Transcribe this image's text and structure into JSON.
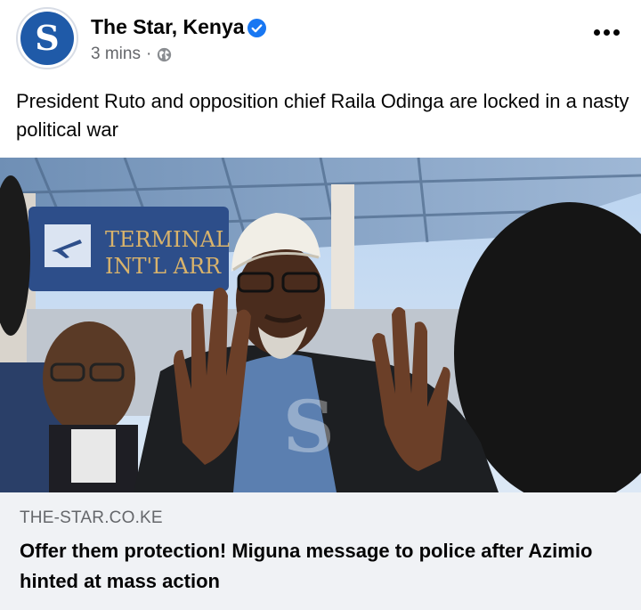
{
  "post": {
    "page_name": "The Star, Kenya",
    "avatar_letter": "S",
    "time": "3 mins",
    "separator": "·",
    "text": "President Ruto and opposition chief Raila Odinga are locked in a nasty political war"
  },
  "image": {
    "sign_line1": "TERMINAL",
    "sign_line2": "INT'L ARR"
  },
  "link_preview": {
    "domain": "THE-STAR.CO.KE",
    "title": "Offer them protection! Miguna message to police after Azimio hinted at mass action"
  },
  "colors": {
    "brand_blue": "#1f5aa8",
    "verified_blue": "#1877f2",
    "preview_bg": "#f0f2f5",
    "meta_gray": "#65676b"
  },
  "icons": {
    "verified": "verified-badge-icon",
    "globe": "globe-icon",
    "more": "more-options-icon"
  }
}
